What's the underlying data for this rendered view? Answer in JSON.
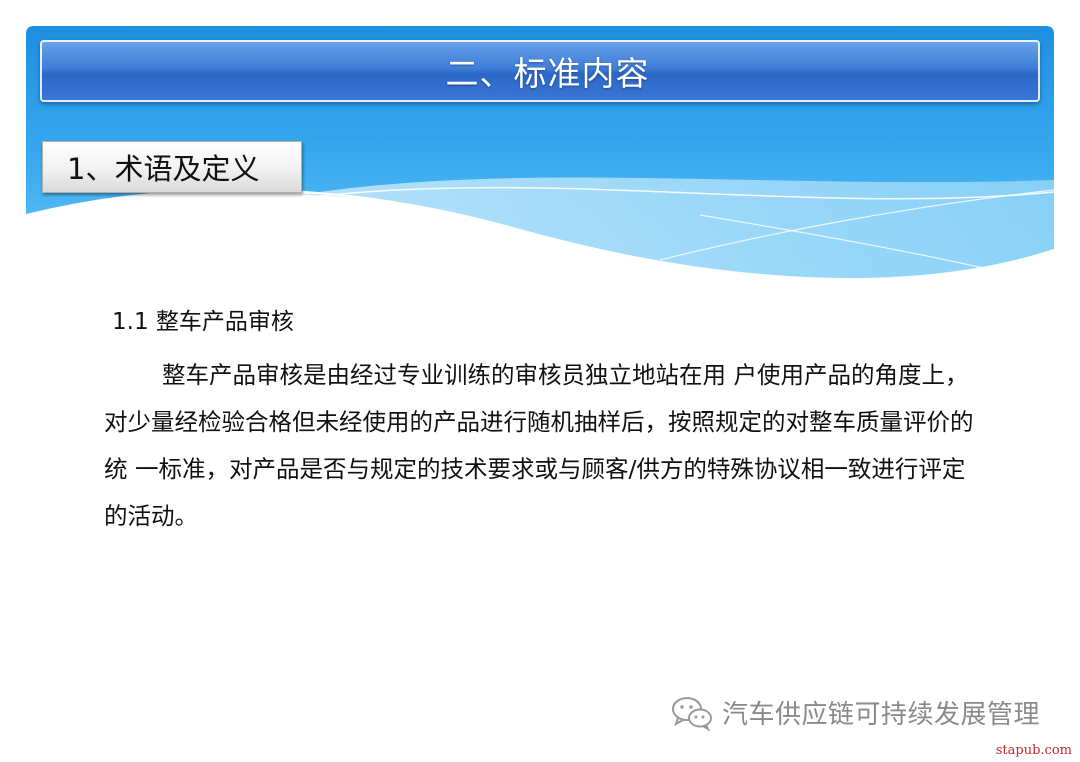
{
  "slide": {
    "title": "二、标准内容",
    "section_label": "1、术语及定义",
    "sub_heading": "1.1 整车产品审核",
    "paragraph": "整车产品审核是由经过专业训练的审核员独立地站在用 户使用产品的角度上，对少量经检验合格但未经使用的产品进行随机抽样后，按照规定的对整车质量评价的统 一标准，对产品是否与规定的技术要求或与顾客/供方的特殊协议相一致进行评定的活动。"
  },
  "watermark": {
    "icon": "wechat-icon",
    "text": "汽车供应链可持续发展管理"
  },
  "site_mark": "stapub.com",
  "colors": {
    "band_top": "#1e8fe0",
    "band_bottom": "#5fc0f2",
    "title_bar": "#3f7fd8",
    "site_mark": "#c7282b"
  }
}
